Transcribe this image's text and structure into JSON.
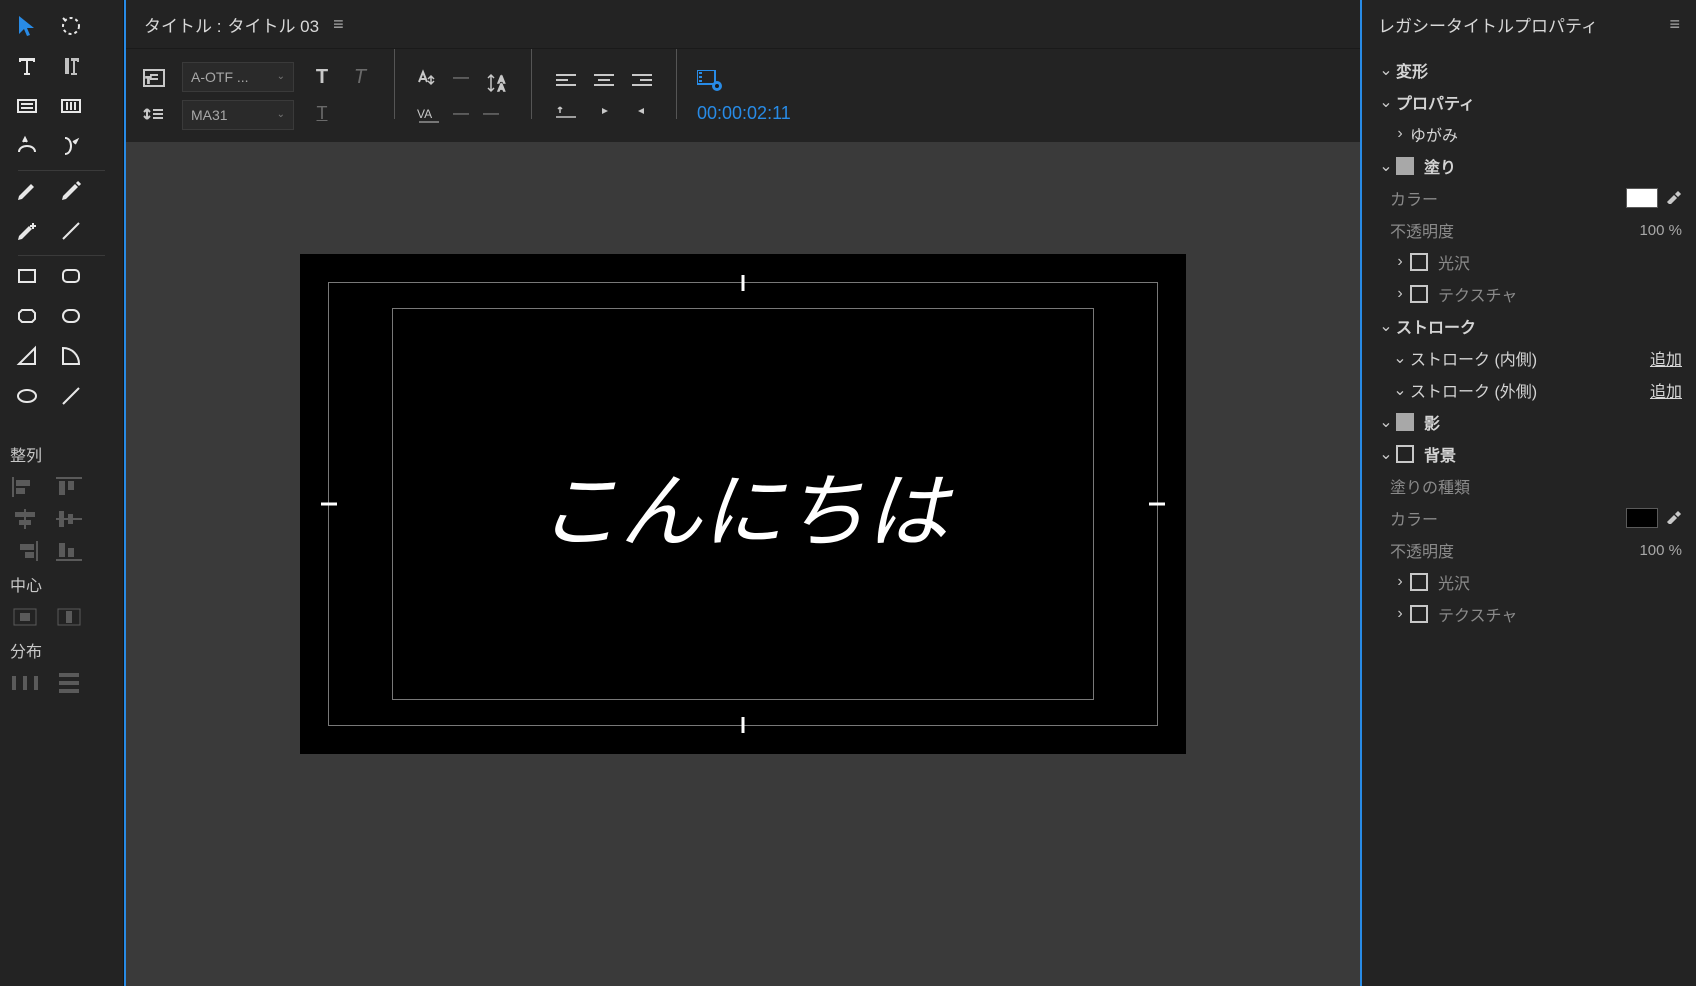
{
  "header": {
    "title_prefix": "タイトル :",
    "title_name": "タイトル 03"
  },
  "toolbar": {
    "font_family": "A-OTF ...",
    "font_style": "MA31",
    "timecode": "00:00:02:11"
  },
  "canvas": {
    "text": "こんにちは"
  },
  "align_panel": {
    "title": "整列",
    "center_title": "中心",
    "distribute_title": "分布"
  },
  "props": {
    "panel_title": "レガシータイトルプロパティ",
    "transform": "変形",
    "properties": "プロパティ",
    "distort": "ゆがみ",
    "fill": "塗り",
    "color": "カラー",
    "opacity": "不透明度",
    "opacity_val": "100 %",
    "gloss": "光沢",
    "texture": "テクスチャ",
    "stroke": "ストローク",
    "stroke_inner": "ストローク (内側)",
    "stroke_outer": "ストローク (外側)",
    "add": "追加",
    "shadow": "影",
    "background": "背景",
    "fill_type": "塗りの種類",
    "bg_opacity_val": "100 %"
  }
}
